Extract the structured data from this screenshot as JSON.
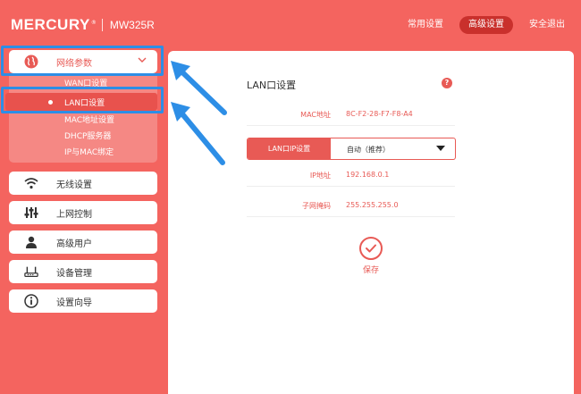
{
  "header": {
    "brand": "MERCURY",
    "trademark": "®",
    "model": "MW325R",
    "nav": [
      {
        "label": "常用设置",
        "active": false
      },
      {
        "label": "高级设置",
        "active": true
      },
      {
        "label": "安全退出",
        "active": false
      }
    ]
  },
  "sidebar": {
    "network": {
      "label": "网络参数",
      "icon": "globe-icon",
      "submenu": [
        {
          "label": "WAN口设置"
        },
        {
          "label": "LAN口设置",
          "active": true
        },
        {
          "label": "MAC地址设置"
        },
        {
          "label": "DHCP服务器"
        },
        {
          "label": "IP与MAC绑定"
        }
      ]
    },
    "items": [
      {
        "label": "无线设置",
        "icon": "wifi-icon"
      },
      {
        "label": "上网控制",
        "icon": "sliders-icon"
      },
      {
        "label": "高级用户",
        "icon": "user-icon"
      },
      {
        "label": "设备管理",
        "icon": "router-icon"
      },
      {
        "label": "设置向导",
        "icon": "info-icon"
      }
    ]
  },
  "main": {
    "title": "LAN口设置",
    "help": "?",
    "mac": {
      "label": "MAC地址",
      "value": "8C-F2-28-F7-F8-A4"
    },
    "lan_ip_mode": {
      "label": "LAN口IP设置",
      "value": "自动（推荐）"
    },
    "ip": {
      "label": "IP地址",
      "value": "192.168.0.1"
    },
    "mask": {
      "label": "子网掩码",
      "value": "255.255.255.0"
    },
    "save_label": "保存"
  },
  "colors": {
    "background": "#f4645f",
    "accent": "#e85a55",
    "highlight": "#2d8ee6"
  }
}
